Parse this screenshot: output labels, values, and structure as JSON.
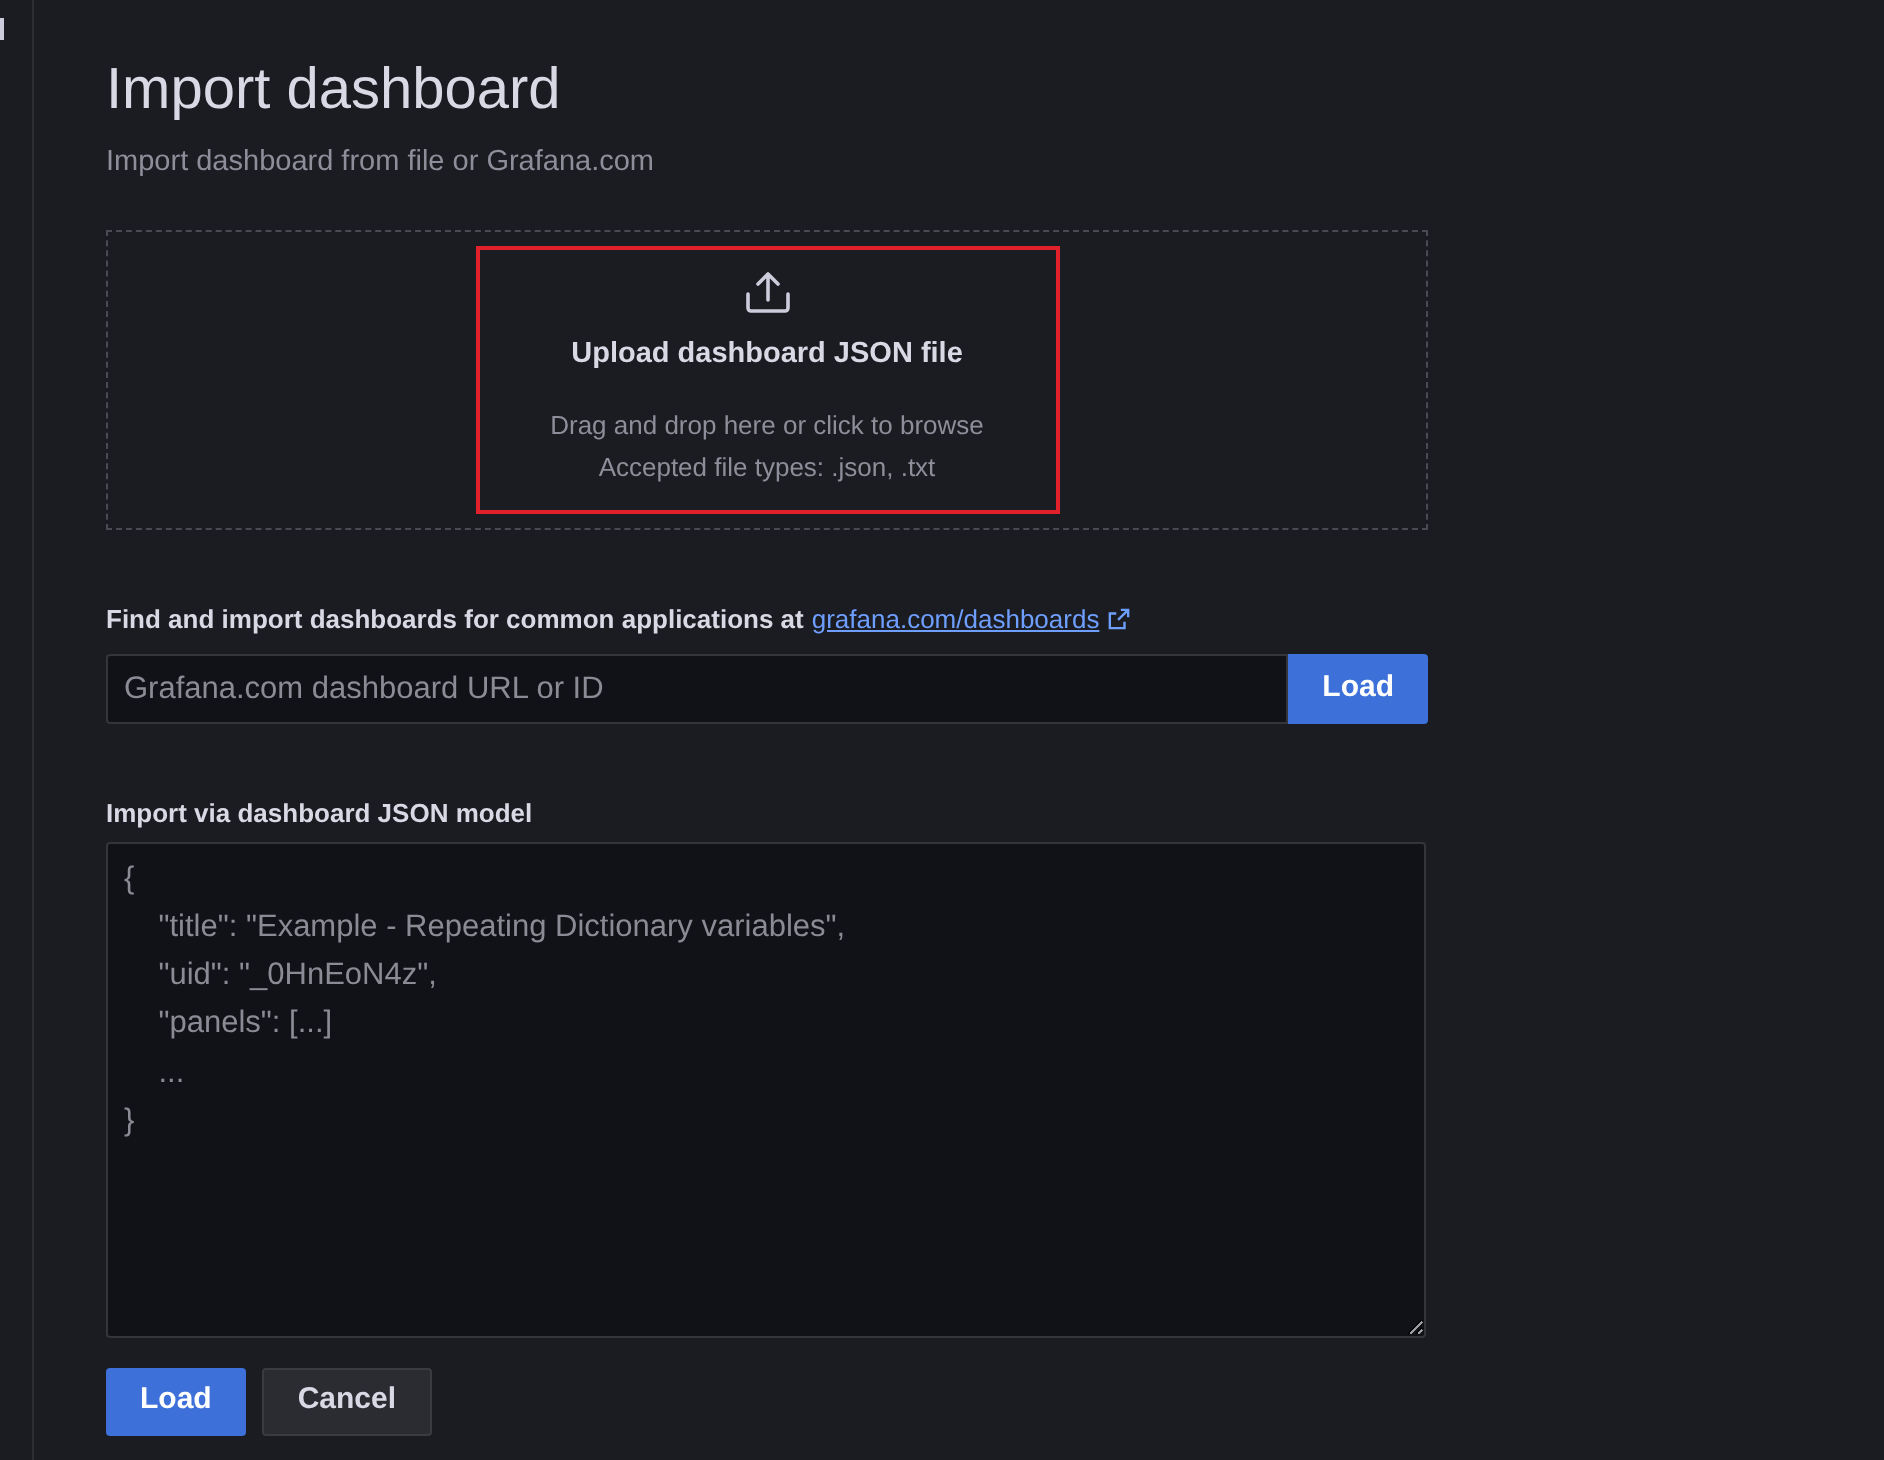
{
  "page": {
    "title": "Import dashboard",
    "subtitle": "Import dashboard from file or Grafana.com"
  },
  "upload": {
    "title": "Upload dashboard JSON file",
    "hint": "Drag and drop here or click to browse",
    "accepted": "Accepted file types: .json, .txt",
    "highlighted": true
  },
  "grafana_com": {
    "label": "Find and import dashboards for common applications at",
    "link": "grafana.com/dashboards",
    "placeholder": "Grafana.com dashboard URL or ID",
    "button": "Load"
  },
  "json_model": {
    "label": "Import via dashboard JSON model",
    "placeholder": "{\n    \"title\": \"Example - Repeating Dictionary variables\",\n    \"uid\": \"_0HnEoN4z\",\n    \"panels\": [...]\n    ...\n}"
  },
  "buttons": [
    {
      "label": "Load",
      "kind": "primary"
    },
    {
      "label": "Cancel",
      "kind": "secondary"
    }
  ]
}
